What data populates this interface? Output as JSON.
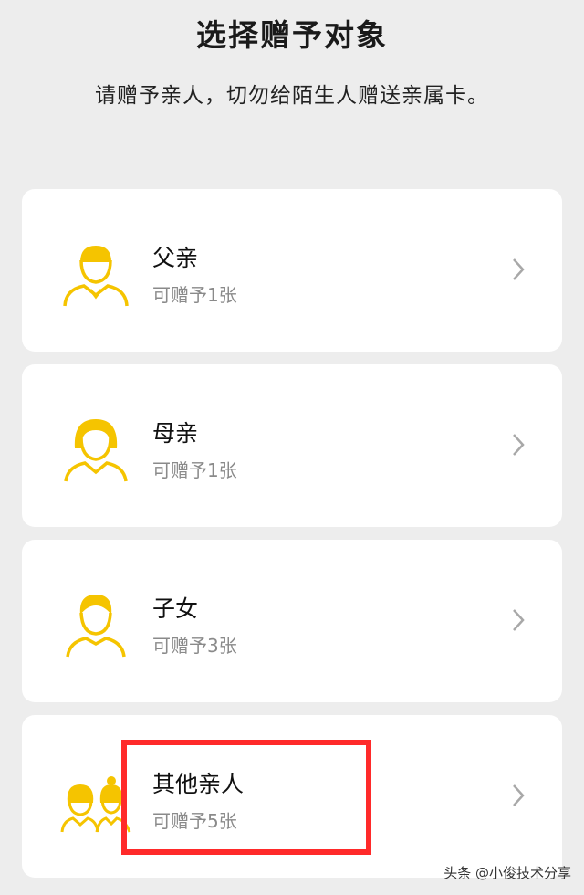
{
  "header": {
    "title": "选择赠予对象",
    "subtitle": "请赠予亲人，切勿给陌生人赠送亲属卡。"
  },
  "options": [
    {
      "name": "父亲",
      "quota": "可赠予1张",
      "icon": "father-icon"
    },
    {
      "name": "母亲",
      "quota": "可赠予1张",
      "icon": "mother-icon"
    },
    {
      "name": "子女",
      "quota": "可赠予3张",
      "icon": "child-icon"
    },
    {
      "name": "其他亲人",
      "quota": "可赠予5张",
      "icon": "other-relatives-icon"
    }
  ],
  "colors": {
    "accent": "#f5c400",
    "highlight": "#ff2a2a",
    "background": "#ededed"
  },
  "watermark": "头条 @小俊技术分享"
}
